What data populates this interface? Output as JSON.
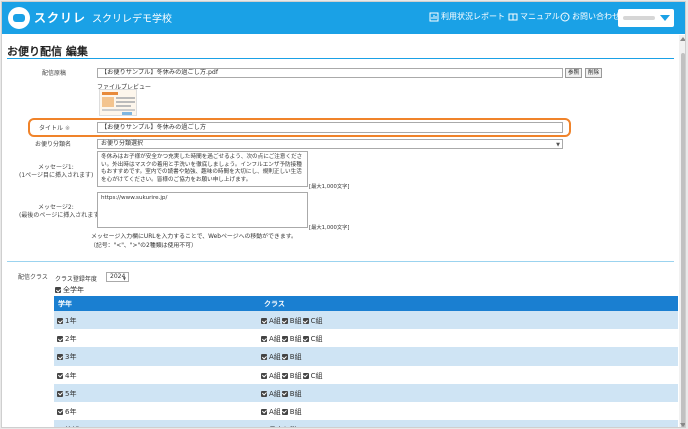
{
  "header": {
    "brand": "スクリレ",
    "school": "スクリレデモ学校",
    "nav": [
      "利用状況レポート",
      "マニュアル",
      "お問い合わせ"
    ]
  },
  "page": {
    "title": "お便り配信 編集"
  },
  "form": {
    "source_label": "配信原稿",
    "source_file": "【お便りサンプル】冬休みの過ごし方.pdf",
    "browse_label": "参照",
    "delete_label": "削除",
    "preview_label": "ファイルプレビュー",
    "title_label": "タイトル",
    "title_required": "※",
    "title_value": "【お便りサンプル】冬休みの過ごし方",
    "category_label": "お便り分類名",
    "category_value": "お便り分類選択",
    "message1_label_1": "メッセージ1:",
    "message1_label_2": "(1ページ目に挿入されます)",
    "message1_value": "冬休みはお子様が安全かつ充実した時間を過ごせるよう、次の点にご注意ください。外出時はマスクの着用と手洗いを徹底しましょう。インフルエンザ予防接種もおすすめです。室内での読書や勉強、趣味の時間を大切にし、規則正しい生活を心がけてください。皆様のご協力をお願い申し上げます。",
    "message1_limit": "[最大1,000文字]",
    "message2_label_1": "メッセージ2:",
    "message2_label_2": "(最後のページに挿入されます)",
    "message2_value": "https://www.sukurire.jp/",
    "message2_limit": "[最大1,000文字]",
    "message_note_1": "メッセージ入力欄にURLを入力することで、Webページへの移動ができます。",
    "message_note_2": "（記号：\"<\"、\">\"の2種類は使用不可）"
  },
  "classes": {
    "label": "配信クラス",
    "year_label": "クラス登録年度",
    "year_value": "2024",
    "all_grades": "全学年",
    "headers": [
      "学年",
      "クラス"
    ],
    "rows": [
      {
        "grade": "1年",
        "classes": [
          "A組",
          "B組",
          "C組"
        ]
      },
      {
        "grade": "2年",
        "classes": [
          "A組",
          "B組",
          "C組"
        ]
      },
      {
        "grade": "3年",
        "classes": [
          "A組",
          "B組"
        ]
      },
      {
        "grade": "4年",
        "classes": [
          "A組",
          "B組",
          "C組"
        ]
      },
      {
        "grade": "5年",
        "classes": [
          "A組",
          "B組"
        ]
      },
      {
        "grade": "6年",
        "classes": [
          "A組",
          "B組"
        ]
      },
      {
        "grade": "地域",
        "classes": [
          "見守り隊"
        ]
      }
    ]
  },
  "colors": {
    "header": "#1aa1e6",
    "table_header": "#1a7fd1",
    "row_stripe": "#cfe4f4",
    "highlight": "#f0832a"
  }
}
